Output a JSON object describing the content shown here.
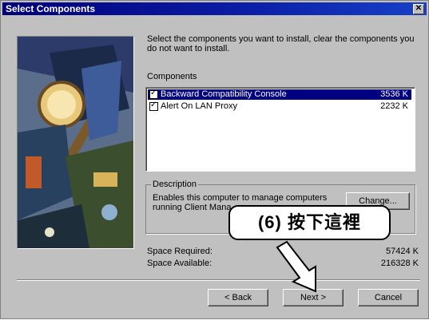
{
  "window": {
    "title": "Select Components"
  },
  "instructions": "Select the components you want to install, clear the components you do not want to install.",
  "components_label": "Components",
  "components": [
    {
      "name": "Backward Compatibility Console",
      "size": "3536 K",
      "checked": true,
      "selected": true
    },
    {
      "name": "Alert On LAN Proxy",
      "size": "2232 K",
      "checked": true,
      "selected": false
    }
  ],
  "description": {
    "legend": "Description",
    "text": "Enables this computer to manage computers running Client Mana"
  },
  "change_button": "Change...",
  "space": {
    "required_label": "Space Required:",
    "required_value": "57424 K",
    "available_label": "Space Available:",
    "available_value": "216328 K"
  },
  "buttons": {
    "back": "< Back",
    "next": "Next >",
    "cancel": "Cancel"
  },
  "annotation": {
    "text": "(6) 按下這裡"
  },
  "colors": {
    "title_bar": "#00007a",
    "selection": "#000080",
    "dialog": "#c0c0c0"
  }
}
